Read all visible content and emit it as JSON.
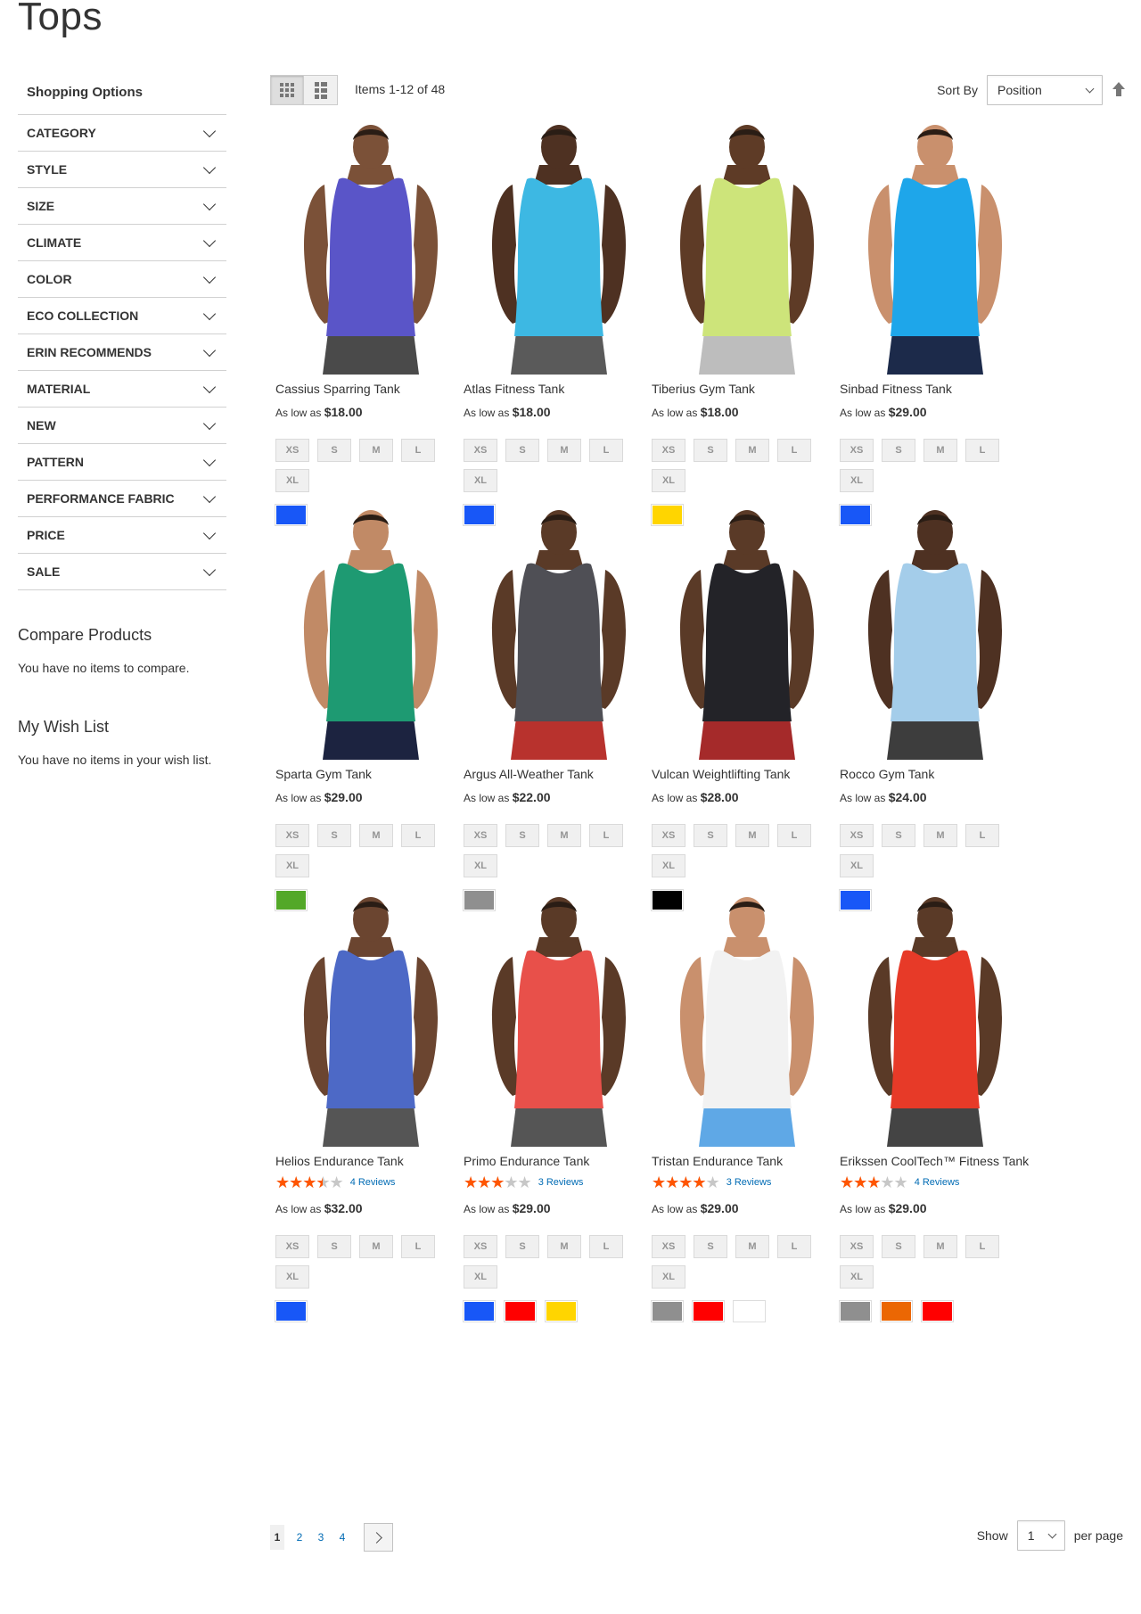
{
  "page": {
    "title": "Tops"
  },
  "sidebar": {
    "title": "Shopping Options",
    "filters": [
      "CATEGORY",
      "STYLE",
      "SIZE",
      "CLIMATE",
      "COLOR",
      "ECO COLLECTION",
      "ERIN RECOMMENDS",
      "MATERIAL",
      "NEW",
      "PATTERN",
      "PERFORMANCE FABRIC",
      "PRICE",
      "SALE"
    ],
    "compare": {
      "title": "Compare Products",
      "text": "You have no items to compare."
    },
    "wishlist": {
      "title": "My Wish List",
      "text": "You have no items in your wish list."
    }
  },
  "toolbar": {
    "amount": "Items 1-12 of 48",
    "sort_label": "Sort By",
    "sort_value": "Position",
    "grid_icon": "grid-icon",
    "list_icon": "list-icon",
    "sort_direction_icon": "arrow-up-icon"
  },
  "price_prefix": "As low as",
  "sizes": [
    "XS",
    "S",
    "M",
    "L",
    "XL"
  ],
  "colors": {
    "blue": "#1857f7",
    "yellow": "#ffd500",
    "green": "#53a828",
    "gray": "#8f8f8f",
    "black": "#000000",
    "red": "#ff0000",
    "white": "#ffffff",
    "orange": "#eb6703",
    "star": "#ff5501"
  },
  "products": [
    {
      "name": "Cassius Sparring Tank",
      "price": "$18.00",
      "shirt": "#5a55c8",
      "skin": "#7b5138",
      "shorts": "#4a4a4a",
      "swatches": [
        "blue"
      ]
    },
    {
      "name": "Atlas Fitness Tank",
      "price": "$18.00",
      "shirt": "#3db8e3",
      "skin": "#4e3122",
      "shorts": "#5a5a5a",
      "swatches": [
        "blue"
      ]
    },
    {
      "name": "Tiberius Gym Tank",
      "price": "$18.00",
      "shirt": "#cde47a",
      "skin": "#5e3b26",
      "shorts": "#bdbdbd",
      "swatches": [
        "yellow"
      ]
    },
    {
      "name": "Sinbad Fitness Tank",
      "price": "$29.00",
      "shirt": "#1ea6ea",
      "skin": "#c9906d",
      "shorts": "#1c2a4a",
      "swatches": [
        "blue"
      ]
    },
    {
      "name": "Sparta Gym Tank",
      "price": "$29.00",
      "shirt": "#1e9a72",
      "skin": "#c18a66",
      "shorts": "#1c2340",
      "swatches": [
        "green"
      ]
    },
    {
      "name": "Argus All-Weather Tank",
      "price": "$22.00",
      "shirt": "#4f4f55",
      "skin": "#5a3a27",
      "shorts": "#b8322d",
      "swatches": [
        "gray"
      ]
    },
    {
      "name": "Vulcan Weightlifting Tank",
      "price": "$28.00",
      "shirt": "#232328",
      "skin": "#5a3a27",
      "shorts": "#a52a2a",
      "swatches": [
        "black"
      ]
    },
    {
      "name": "Rocco Gym Tank",
      "price": "$24.00",
      "shirt": "#a4cdea",
      "skin": "#4e3122",
      "shorts": "#3d3d3d",
      "swatches": [
        "blue"
      ]
    },
    {
      "name": "Helios Endurance Tank",
      "price": "$32.00",
      "shirt": "#4d69c6",
      "skin": "#6b4530",
      "shorts": "#555555",
      "swatches": [
        "blue"
      ],
      "rating": 0.7,
      "reviews": "4 Reviews"
    },
    {
      "name": "Primo Endurance Tank",
      "price": "$29.00",
      "shirt": "#e8504a",
      "skin": "#5a3a27",
      "shorts": "#555555",
      "swatches": [
        "blue",
        "red",
        "yellow"
      ],
      "rating": 0.6,
      "reviews": "3 Reviews"
    },
    {
      "name": "Tristan Endurance Tank",
      "price": "$29.00",
      "shirt": "#f2f2f2",
      "skin": "#c9906d",
      "shorts": "#5fa8e6",
      "swatches": [
        "gray",
        "red",
        "white"
      ],
      "rating": 0.8,
      "reviews": "3 Reviews"
    },
    {
      "name": "Erikssen CoolTech™ Fitness Tank",
      "price": "$29.00",
      "shirt": "#e73a28",
      "skin": "#5a3a27",
      "shorts": "#444444",
      "swatches": [
        "gray",
        "orange",
        "red"
      ],
      "rating": 0.6,
      "reviews": "4 Reviews"
    }
  ],
  "pager": {
    "pages": [
      "1",
      "2",
      "3",
      "4"
    ],
    "next_icon": "chevron-right-icon",
    "show_label": "Show",
    "limit_value": "1",
    "per_page_label": "per page"
  }
}
